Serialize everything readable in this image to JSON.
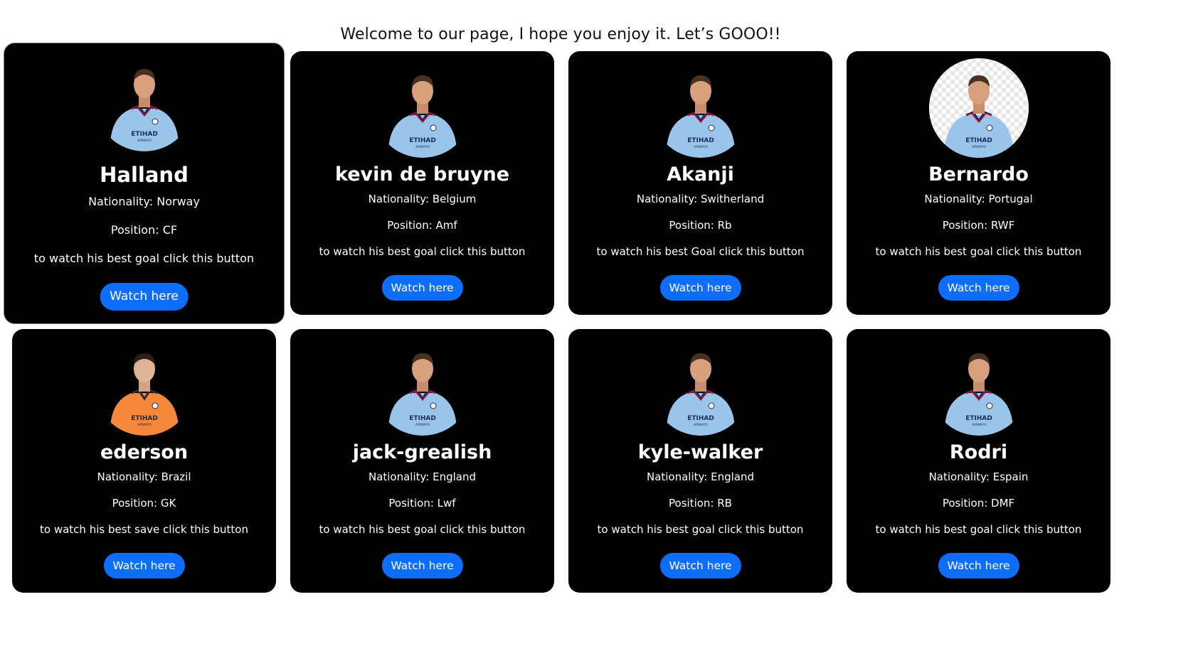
{
  "page": {
    "title": "Welcome to our page, I hope you enjoy it. Let’s GOOO!!"
  },
  "colors": {
    "card_bg": "#000000",
    "button": "#0d6efd",
    "home_kit": "#99c5ea",
    "gk_kit": "#f5883a"
  },
  "players": [
    {
      "name": "Halland",
      "nationality": "Nationality: Norway",
      "position": "Position: CF",
      "cta": "to watch his best goal click this button",
      "button": "Watch here",
      "photo_icon": "player-home-kit-icon"
    },
    {
      "name": "kevin de bruyne",
      "nationality": "Nationality: Belgium",
      "position": "Position: Amf",
      "cta": "to watch his best goal click this button",
      "button": "Watch here",
      "photo_icon": "player-home-kit-icon"
    },
    {
      "name": "Akanji",
      "nationality": "Nationality: Switherland",
      "position": "Position: Rb",
      "cta": "to watch his best Goal click this button",
      "button": "Watch here",
      "photo_icon": "player-home-kit-icon"
    },
    {
      "name": "Bernardo",
      "nationality": "Nationality: Portugal",
      "position": "Position: RWF",
      "cta": "to watch his best goal click this button",
      "button": "Watch here",
      "photo_icon": "player-home-kit-icon"
    },
    {
      "name": "ederson",
      "nationality": "Nationality: Brazil",
      "position": "Position: GK",
      "cta": "to watch his best save click this button",
      "button": "Watch here",
      "photo_icon": "player-goalkeeper-kit-icon"
    },
    {
      "name": "jack-grealish",
      "nationality": "Nationality: England",
      "position": "Position: Lwf",
      "cta": "to watch his best goal click this button",
      "button": "Watch here",
      "photo_icon": "player-home-kit-icon"
    },
    {
      "name": "kyle-walker",
      "nationality": "Nationality: England",
      "position": "Position: RB",
      "cta": "to watch his best goal click this button",
      "button": "Watch here",
      "photo_icon": "player-home-kit-icon"
    },
    {
      "name": "Rodri",
      "nationality": "Nationality: Espain",
      "position": "Position: DMF",
      "cta": "to watch his best goal click this button",
      "button": "Watch here",
      "photo_icon": "player-home-kit-icon"
    }
  ]
}
